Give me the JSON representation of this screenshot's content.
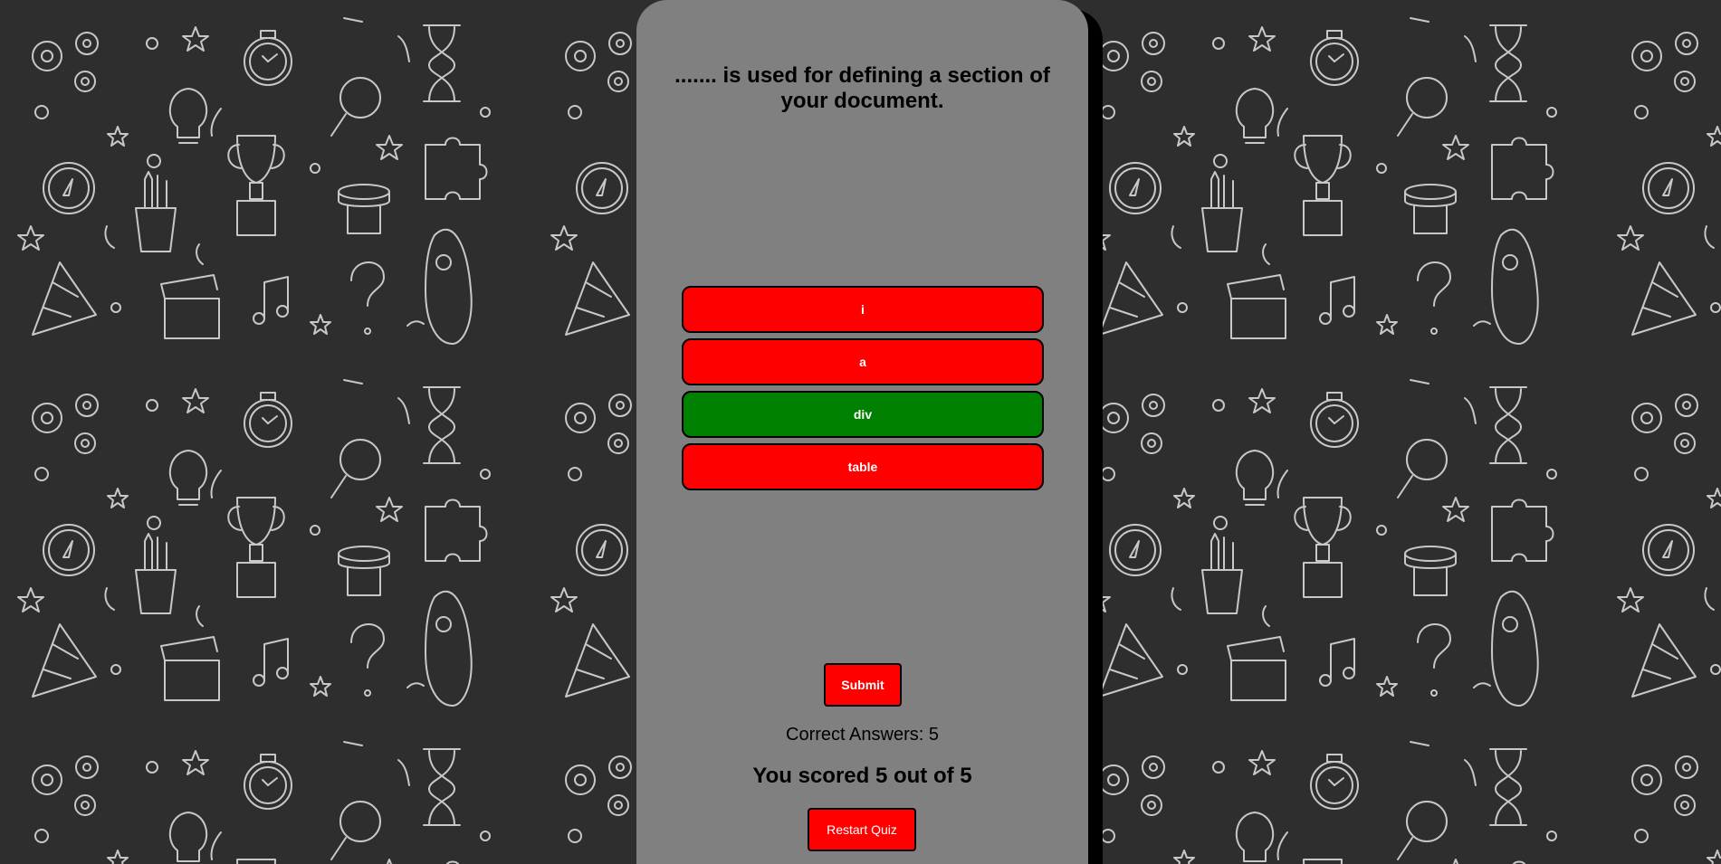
{
  "quiz": {
    "question": "....... is used for defining a section of your document.",
    "options": [
      {
        "label": "i",
        "state": "wrong"
      },
      {
        "label": "a",
        "state": "wrong"
      },
      {
        "label": "div",
        "state": "correct"
      },
      {
        "label": "table",
        "state": "wrong"
      }
    ],
    "submit_label": "Submit",
    "correct_answers_text": "Correct Answers: 5",
    "score_text": "You scored 5 out of 5",
    "restart_label": "Restart Quiz"
  },
  "colors": {
    "background": "#2e2e2e",
    "card": "#808080",
    "wrong": "#ff0000",
    "correct": "#008000",
    "doodle": "#c8c8c8"
  },
  "background_icons": [
    "gear-icon",
    "stopwatch-icon",
    "hourglass-icon",
    "lightbulb-icon",
    "magnifier-icon",
    "trophy-icon",
    "compass-icon",
    "pencil-cup-icon",
    "buzzer-icon",
    "puzzle-icon",
    "rocket-icon",
    "party-hat-icon",
    "clapperboard-icon",
    "music-note-icon",
    "question-mark-icon",
    "star-icon"
  ]
}
